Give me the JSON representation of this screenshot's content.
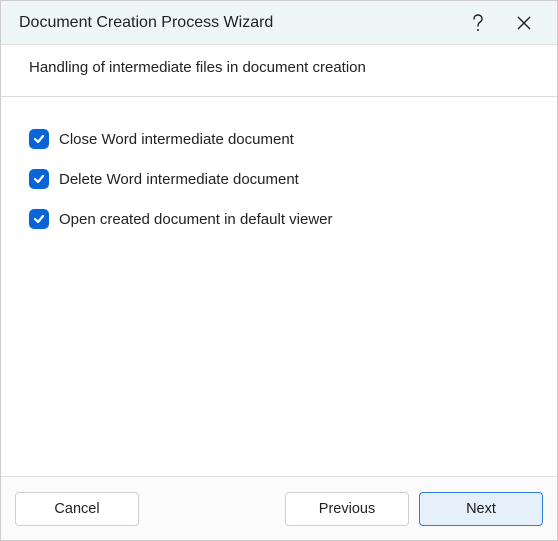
{
  "titlebar": {
    "title": "Document Creation Process Wizard"
  },
  "header": {
    "subtitle": "Handling of intermediate files in document creation"
  },
  "options": [
    {
      "label": "Close Word intermediate document",
      "checked": true
    },
    {
      "label": "Delete Word intermediate document",
      "checked": true
    },
    {
      "label": "Open created document in default viewer",
      "checked": true
    }
  ],
  "footer": {
    "cancel": "Cancel",
    "previous": "Previous",
    "next": "Next"
  }
}
